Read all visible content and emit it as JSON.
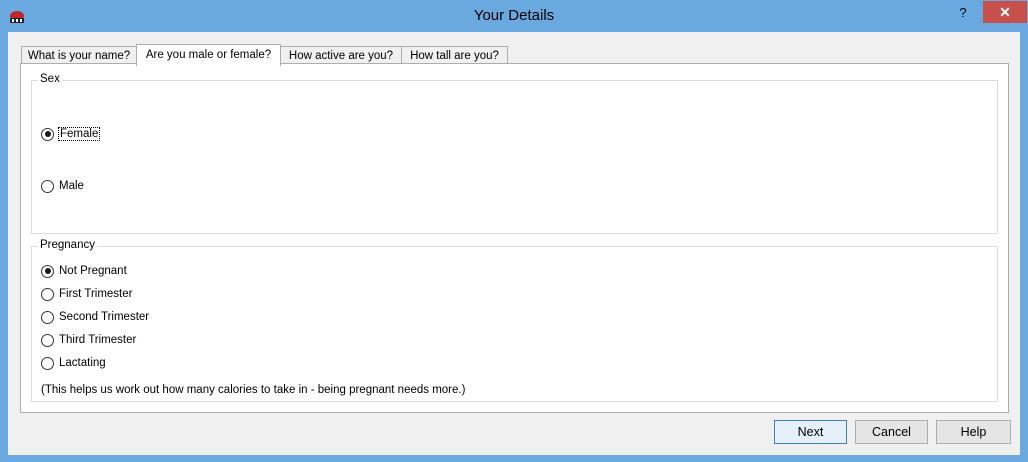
{
  "window": {
    "title": "Your Details",
    "help_label": "?",
    "close_label": "✕"
  },
  "tabs": [
    {
      "label": "What is your name?",
      "active": false
    },
    {
      "label": "Are you male or female?",
      "active": true
    },
    {
      "label": "How active are you?",
      "active": false
    },
    {
      "label": "How tall are you?",
      "active": false
    }
  ],
  "sex": {
    "title": "Sex",
    "options": [
      {
        "label": "Female",
        "checked": true
      },
      {
        "label": "Male",
        "checked": false
      }
    ]
  },
  "pregnancy": {
    "title": "Pregnancy",
    "options": [
      {
        "label": "Not Pregnant",
        "checked": true
      },
      {
        "label": "First Trimester",
        "checked": false
      },
      {
        "label": "Second Trimester",
        "checked": false
      },
      {
        "label": "Third Trimester",
        "checked": false
      },
      {
        "label": "Lactating",
        "checked": false
      }
    ],
    "note": "(This helps us work out how many calories to take in - being pregnant needs more.)"
  },
  "buttons": {
    "next": "Next",
    "cancel": "Cancel",
    "help": "Help"
  },
  "colors": {
    "titlebar": "#6aa9df",
    "close": "#c7504a"
  }
}
